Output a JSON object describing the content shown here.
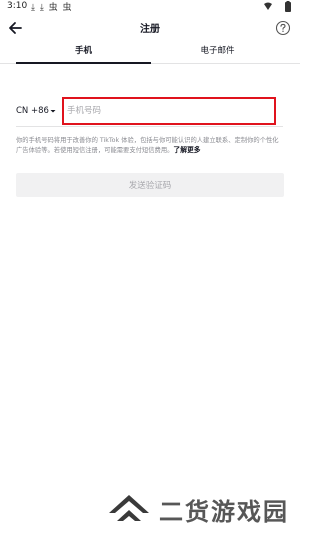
{
  "status_bar": {
    "time": "3:10",
    "notifications": "⤓ ⤓ 虫 虫"
  },
  "header": {
    "title": "注册"
  },
  "tabs": [
    {
      "label": "手机",
      "active": true
    },
    {
      "label": "电子邮件",
      "active": false
    }
  ],
  "form": {
    "country_code": "CN +86",
    "phone_placeholder": "手机号码",
    "disclaimer": "你的手机号码将用于改善你的 TikTok 体验，包括与你可能认识的人建立联系、定制你的个性化广告体验等。若使用短信注册，可能需要支付短信费用。",
    "learn_more": "了解更多",
    "send_button": "发送验证码"
  },
  "watermark": {
    "text": "二货游戏园"
  },
  "colors": {
    "accent_border": "#e0131d",
    "text_primary": "#161823",
    "text_secondary": "#8a8b91",
    "button_disabled_bg": "#f1f1f2"
  }
}
